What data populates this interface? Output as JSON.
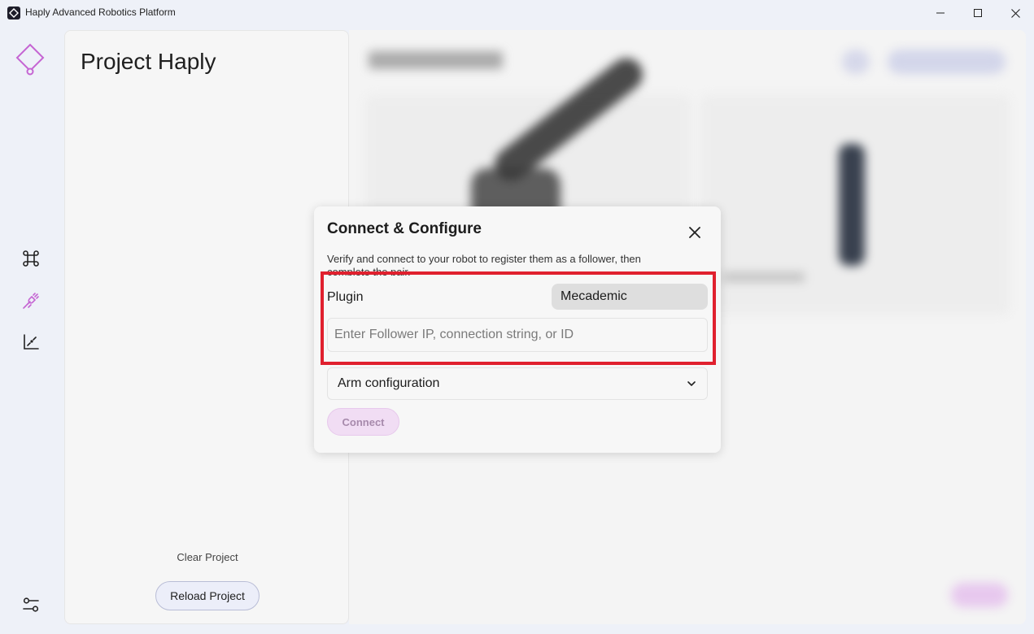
{
  "window": {
    "title": "Haply Advanced Robotics Platform",
    "icon": "haply-app-icon",
    "controls": [
      "minimize-icon",
      "maximize-icon",
      "close-icon"
    ]
  },
  "rail": {
    "items": [
      {
        "name": "haply-logo-icon"
      },
      {
        "name": "command-icon"
      },
      {
        "name": "plug-icon",
        "active": true
      },
      {
        "name": "chart-icon"
      },
      {
        "name": "settings-sliders-icon"
      }
    ],
    "accent_color": "#c565d3"
  },
  "project": {
    "title": "Project Haply",
    "clear_label": "Clear Project",
    "reload_label": "Reload Project"
  },
  "modal": {
    "title": "Connect & Configure",
    "description": "Verify and connect to your robot to register them as a follower, then complete the pair.",
    "plugin_label": "Plugin",
    "plugin_value": "Mecademic",
    "follower_placeholder": "Enter Follower IP, connection string, or ID",
    "follower_value": "",
    "arm_config_label": "Arm configuration",
    "connect_label": "Connect"
  },
  "highlight_color": "#e0202e"
}
